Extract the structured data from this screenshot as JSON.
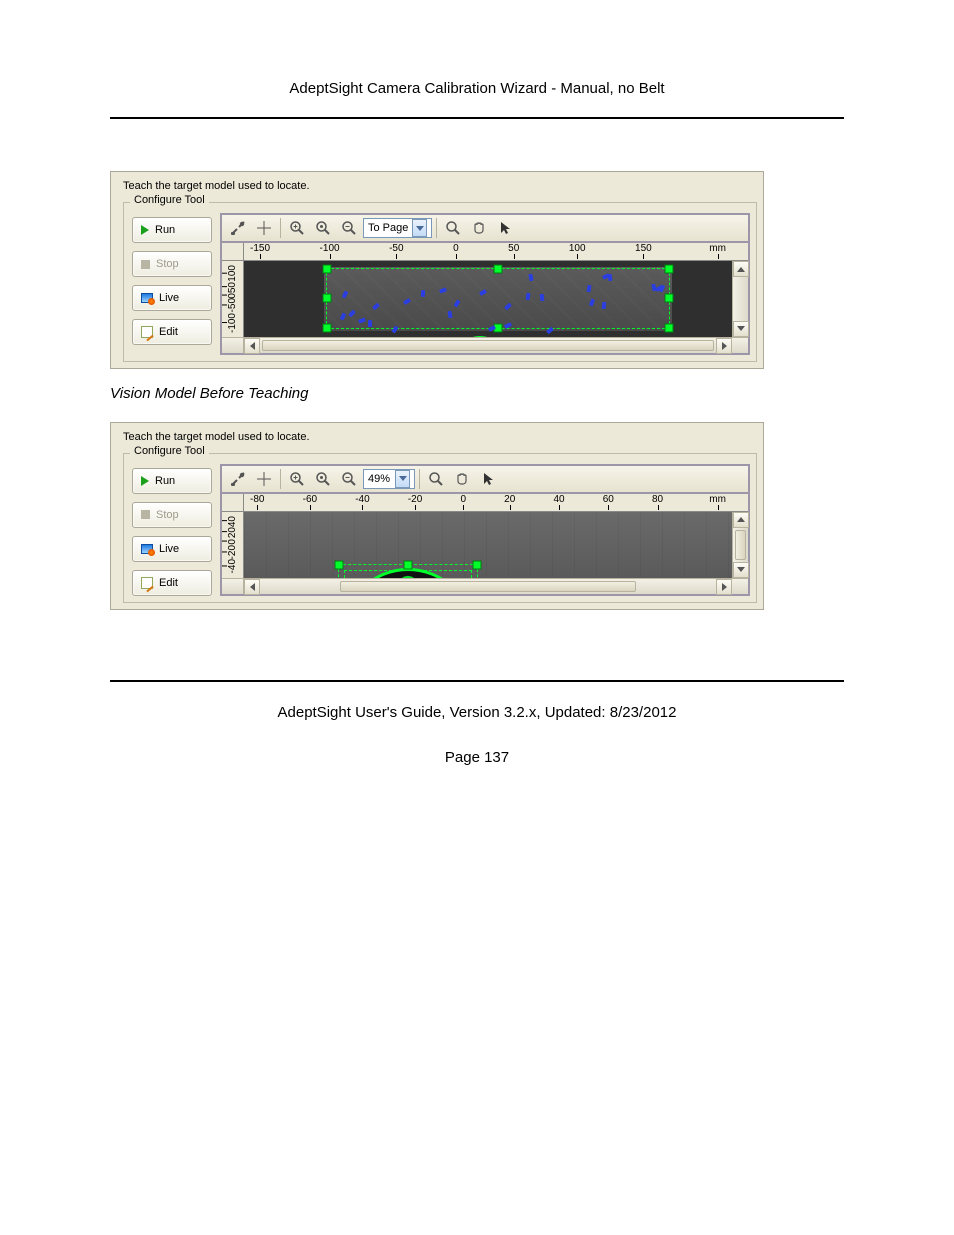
{
  "page": {
    "header": "AdeptSight Camera Calibration Wizard - Manual, no Belt",
    "footer_line": "AdeptSight User's Guide,  Version 3.2.x, Updated: 8/23/2012",
    "page_label": "Page 137"
  },
  "caption1": "Vision Model Before Teaching",
  "screenshot": {
    "instruction": "Teach the target model used to locate.",
    "group_label": "Configure Tool",
    "buttons": {
      "run": "Run",
      "stop": "Stop",
      "live": "Live",
      "edit": "Edit"
    },
    "toolbar_icons": {
      "tools": "tools-icon",
      "crosshair": "crosshair-icon",
      "zoom_in": "zoom-in-icon",
      "zoom_fit": "zoom-fit-icon",
      "zoom_out": "zoom-out-icon",
      "magnify": "magnify-icon",
      "hand": "hand-pan-icon",
      "pointer": "pointer-icon"
    },
    "unit": "mm"
  },
  "shot1": {
    "zoom_label": "To Page",
    "x_ticks": [
      "-150",
      "-100",
      "-50",
      "0",
      "50",
      "100",
      "150"
    ],
    "y_ticks": [
      "100",
      "50",
      "0",
      "-50",
      "-100"
    ]
  },
  "shot2": {
    "zoom_label": "49%",
    "x_ticks": [
      "-80",
      "-60",
      "-40",
      "-20",
      "0",
      "20",
      "40",
      "60",
      "80"
    ],
    "y_ticks": [
      "40",
      "20",
      "0",
      "-20",
      "-40"
    ]
  }
}
